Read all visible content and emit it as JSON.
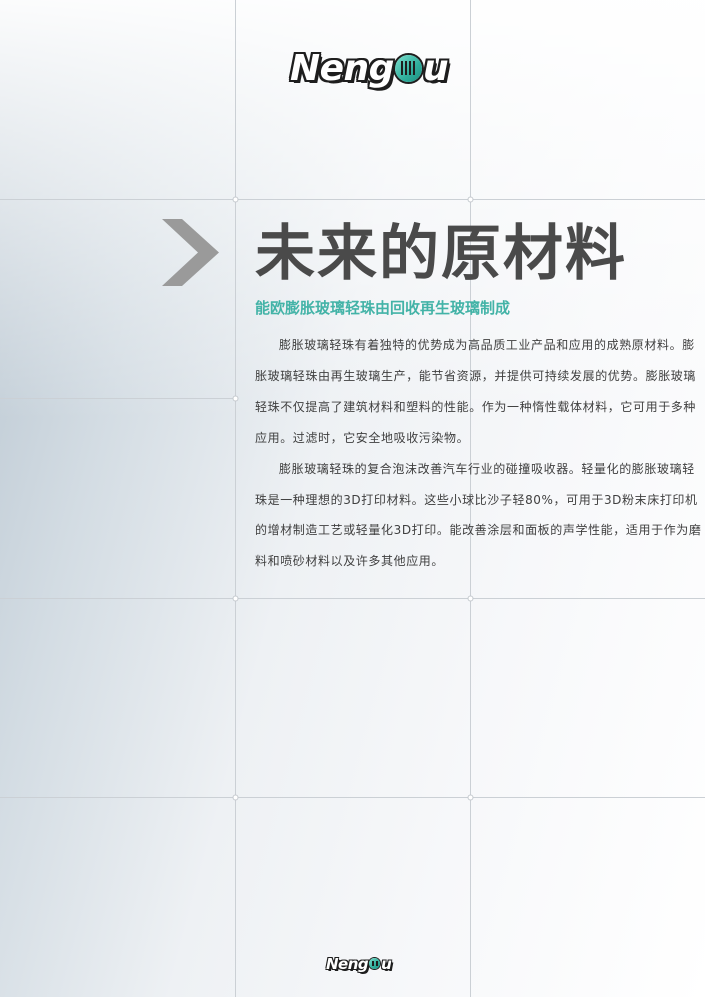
{
  "brand": {
    "name_prefix": "Neng",
    "name_suffix": "u"
  },
  "heading": {
    "chevron_icon": "chevron-right-icon",
    "title": "未来的原材料",
    "subtitle": "能欧膨胀玻璃轻珠由回收再生玻璃制成"
  },
  "body": {
    "paragraphs": [
      "膨胀玻璃轻珠有着独特的优势成为高品质工业产品和应用的成熟原材料。膨胀玻璃轻珠由再生玻璃生产，能节省资源，并提供可持续发展的优势。膨胀玻璃轻珠不仅提高了建筑材料和塑料的性能。作为一种惰性载体材料，它可用于多种应用。过滤时，它安全地吸收污染物。",
      "膨胀玻璃轻珠的复合泡沫改善汽车行业的碰撞吸收器。轻量化的膨胀玻璃轻珠是一种理想的3D打印材料。这些小球比沙子轻80%，可用于3D粉末床打印机的增材制造工艺或轻量化3D打印。能改善涂层和面板的声学性能，适用于作为磨料和喷砂材料以及许多其他应用。"
    ]
  },
  "colors": {
    "accent": "#43b3a7",
    "title": "#4a4a4a",
    "body_text": "#3f3f3f",
    "grid_line": "#c9ced3",
    "chevron": "#9a9a9a"
  }
}
